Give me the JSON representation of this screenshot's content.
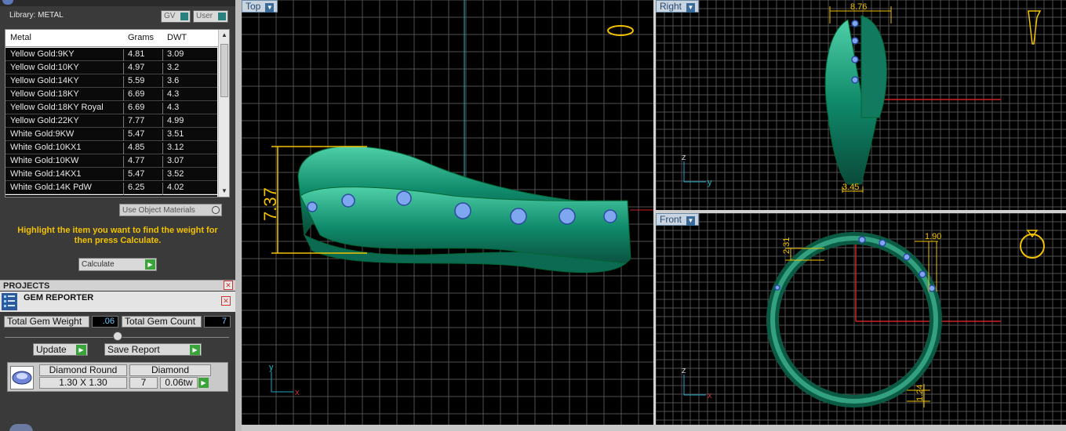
{
  "library": {
    "title": "Library: METAL",
    "gv_label": "GV",
    "user_label": "User",
    "columns": [
      "Metal",
      "Grams",
      "DWT"
    ],
    "rows": [
      {
        "metal": "Yellow Gold:9KY",
        "grams": "4.81",
        "dwt": "3.09"
      },
      {
        "metal": "Yellow Gold:10KY",
        "grams": "4.97",
        "dwt": "3.2"
      },
      {
        "metal": "Yellow Gold:14KY",
        "grams": "5.59",
        "dwt": "3.6"
      },
      {
        "metal": "Yellow Gold:18KY",
        "grams": "6.69",
        "dwt": "4.3"
      },
      {
        "metal": "Yellow Gold:18KY Royal",
        "grams": "6.69",
        "dwt": "4.3"
      },
      {
        "metal": "Yellow Gold:22KY",
        "grams": "7.77",
        "dwt": "4.99"
      },
      {
        "metal": "White Gold:9KW",
        "grams": "5.47",
        "dwt": "3.51"
      },
      {
        "metal": "White Gold:10KX1",
        "grams": "4.85",
        "dwt": "3.12"
      },
      {
        "metal": "White Gold:10KW",
        "grams": "4.77",
        "dwt": "3.07"
      },
      {
        "metal": "White Gold:14KX1",
        "grams": "5.47",
        "dwt": "3.52"
      },
      {
        "metal": "White Gold:14K PdW",
        "grams": "6.25",
        "dwt": "4.02"
      }
    ],
    "use_object_materials": "Use Object Materials",
    "hint": "Highlight the item you want to find the weight for then press Calculate.",
    "calculate_label": "Calculate"
  },
  "projects": {
    "title": "PROJECTS"
  },
  "gem_reporter": {
    "title": "GEM REPORTER",
    "total_weight_label": "Total Gem Weight",
    "total_weight_value": ".06",
    "total_count_label": "Total Gem Count",
    "total_count_value": "7",
    "update_label": "Update",
    "save_report_label": "Save Report",
    "gem": {
      "shape": "Diamond Round",
      "size": "1.30 X 1.30",
      "type": "Diamond",
      "count": "7",
      "weight": "0.06tw"
    }
  },
  "viewports": {
    "top": {
      "label": "Top",
      "dimension": "7.37"
    },
    "right": {
      "label": "Right",
      "dimension_top": "8.76",
      "dimension_bottom": "3.45"
    },
    "front": {
      "label": "Front",
      "dimension_left": "2.31",
      "dimension_right": "1.90",
      "dimension_bottom": "1.24"
    }
  },
  "axes": {
    "x": "x",
    "y": "y",
    "z": "z"
  },
  "colors": {
    "ring": "#0f8a6a",
    "ring_light": "#4fd0a8",
    "gem": "#7fa7f0",
    "dimension": "#f2c200",
    "grid": "#5a5a5a",
    "axis_red": "#cc2222",
    "axis_cyan": "#22b8c8"
  }
}
